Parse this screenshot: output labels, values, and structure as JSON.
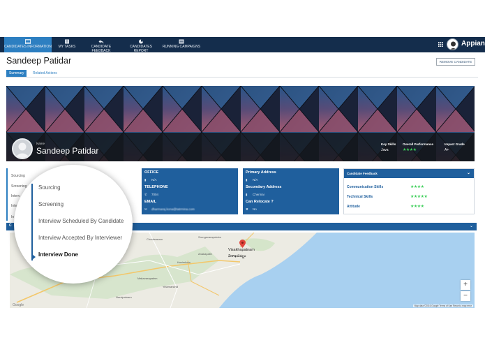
{
  "nav": {
    "items": [
      {
        "label": "CANDIDATES INFORMATION",
        "icon": "table-icon",
        "active": true
      },
      {
        "label": "MY TASKS",
        "icon": "tasks-icon"
      },
      {
        "label": "CANDIDATE FEEDBACK",
        "icon": "reply-icon"
      },
      {
        "label": "CANDIDATES REPORT",
        "icon": "pie-chart-icon"
      },
      {
        "label": "RUNNING CAMPAIGNS",
        "icon": "list-icon"
      }
    ],
    "brand": "Appian"
  },
  "header": {
    "title": "Sandeep Patidar",
    "remove_button": "REMOVE CANDIDATE",
    "tabs": [
      "Summary",
      "Related Actions"
    ]
  },
  "banner": {
    "name_label": "Name",
    "name": "Sandeep Patidar",
    "key_skills_label": "Key Skills",
    "key_skills": "Java",
    "overall_label": "Overall Performance",
    "overall_stars": "★★★★",
    "impact_label": "Impact Grade",
    "impact": "A+"
  },
  "stages": {
    "items": [
      "Sourcing",
      "Screening",
      "Interview Scheduled By Candidate",
      "Interview Accepted By Interviewer",
      "Interview Done"
    ],
    "truncated": [
      "Sourcing",
      "Screening",
      "Interv",
      "Interv",
      "In"
    ]
  },
  "contact": {
    "office_label": "OFFICE",
    "office": "N/A",
    "telephone_label": "TELEPHONE",
    "telephone": "7004",
    "email_label": "EMAIL",
    "email": "dharmaraj.kona@tatrmina.com"
  },
  "address": {
    "primary_label": "Primary Address",
    "primary": "N/A",
    "secondary_label": "Secondary Address",
    "secondary": "Chennai",
    "relocate_label": "Can Relocate ?",
    "relocate": "No"
  },
  "feedback": {
    "title": "Candidate Feedback",
    "rows": [
      {
        "label": "Communication Skills",
        "stars": "★★★★"
      },
      {
        "label": "Technical Skills",
        "stars": "★★★★★"
      },
      {
        "label": "Attitude",
        "stars": "★★★★"
      }
    ]
  },
  "map": {
    "section_label": "C",
    "city": "Visakhapatnam",
    "city_local": "విశాఖపట్నం",
    "places": [
      "Anakapalle",
      "Chodavaram",
      "Makavarapalem",
      "Narsipatnam",
      "Kasimkota",
      "Yelamanchili",
      "Srungavarapukota"
    ],
    "attribution": "Map data ©2016 Google   Terms of Use   Report a map error",
    "google": "Google",
    "zoom_in": "+",
    "zoom_out": "−"
  }
}
